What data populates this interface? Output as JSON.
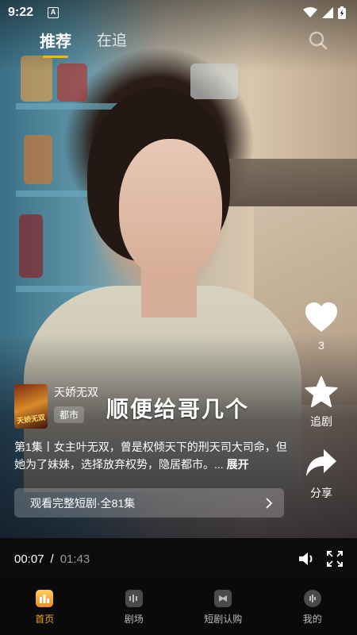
{
  "status_bar": {
    "time": "9:22",
    "app_badge": "A",
    "icons": [
      "wifi-icon",
      "signal-icon",
      "battery-icon"
    ]
  },
  "top_tabs": [
    {
      "label": "推荐",
      "active": true
    },
    {
      "label": "在追",
      "active": false
    }
  ],
  "actions": {
    "like_count": "3",
    "follow_label": "追剧",
    "share_label": "分享"
  },
  "drama": {
    "poster_text": "天娇无双",
    "title": "天娇无双",
    "tag": "都市",
    "subtitle": "顺便给哥几个",
    "episode_desc": "第1集丨女主叶无双，曾是权倾天下的刑天司大司命，但她为了妹妹，选择放弃权势，隐居都市。...",
    "more_label": "展开",
    "watch_full_label": "观看完整短剧·全81集"
  },
  "player": {
    "current_time": "00:07",
    "separator": "/",
    "duration": "01:43"
  },
  "bottom_nav": [
    {
      "label": "首页",
      "active": true,
      "icon": "home-icon"
    },
    {
      "label": "剧场",
      "active": false,
      "icon": "theater-icon"
    },
    {
      "label": "短剧认购",
      "active": false,
      "icon": "subscribe-icon"
    },
    {
      "label": "我的",
      "active": false,
      "icon": "profile-icon"
    }
  ],
  "colors": {
    "accent": "#f5b31c",
    "nav_active": "#f5a623",
    "nav_bg": "#0a0a0a"
  }
}
